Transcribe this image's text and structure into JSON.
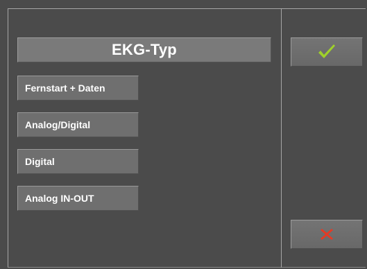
{
  "title": "EKG-Typ",
  "options": [
    {
      "label": "Fernstart + Daten"
    },
    {
      "label": "Analog/Digital"
    },
    {
      "label": "Digital"
    },
    {
      "label": "Analog IN-OUT"
    }
  ],
  "actions": {
    "confirm": {
      "icon": "checkmark-icon",
      "color": "#9fd12a"
    },
    "cancel": {
      "icon": "x-icon",
      "color": "#e63a24"
    }
  },
  "colors": {
    "background": "#4b4b4b",
    "button": "#6f6f6f",
    "title_bar": "#7a7a7a",
    "text": "#ffffff"
  }
}
